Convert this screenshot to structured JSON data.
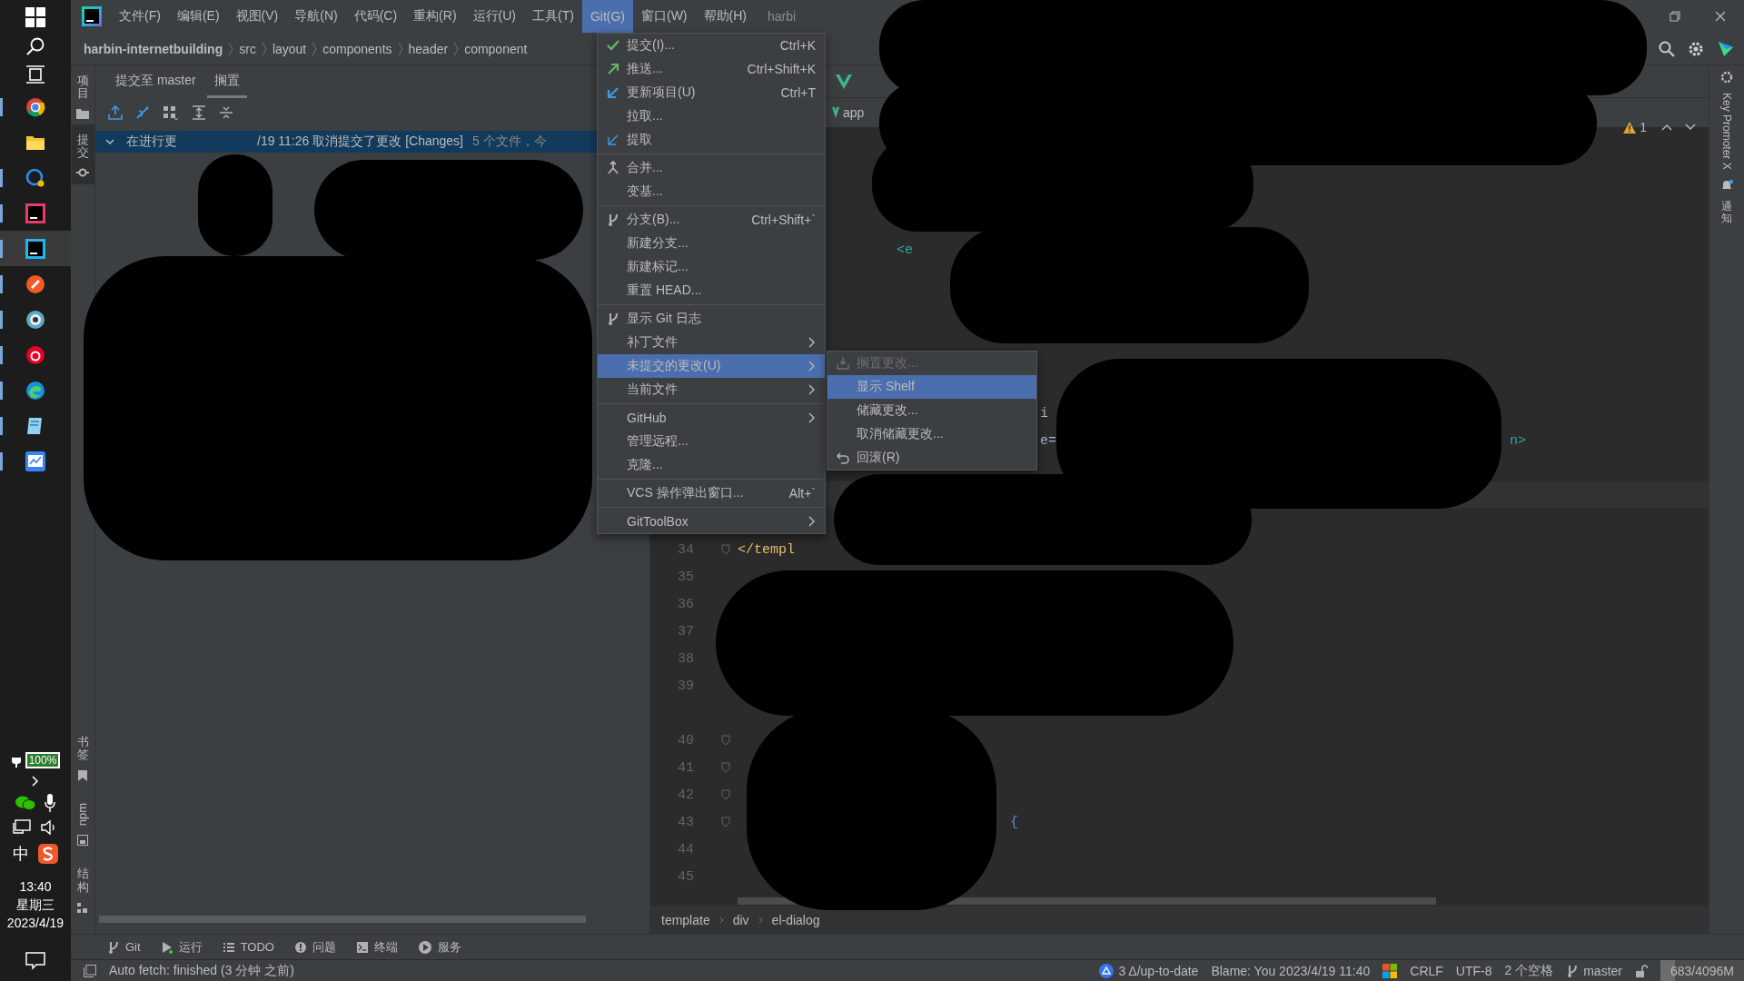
{
  "taskbar": {
    "apps": [
      {
        "kind": "chrome",
        "running": true,
        "selected": false
      },
      {
        "kind": "folder",
        "running": false,
        "selected": false
      },
      {
        "kind": "chat",
        "running": true,
        "selected": false
      },
      {
        "kind": "intellij",
        "running": true,
        "selected": false
      },
      {
        "kind": "webstorm",
        "running": true,
        "selected": true
      },
      {
        "kind": "pen",
        "running": true,
        "selected": false
      },
      {
        "kind": "globe",
        "running": true,
        "selected": false
      },
      {
        "kind": "music",
        "running": true,
        "selected": false
      },
      {
        "kind": "edge",
        "running": true,
        "selected": false
      },
      {
        "kind": "note",
        "running": true,
        "selected": false
      },
      {
        "kind": "board",
        "running": true,
        "selected": false
      }
    ],
    "battery": "100%",
    "input_method": "中",
    "time": "13:40",
    "weekday": "星期三",
    "date": "2023/4/19"
  },
  "menu_bar": {
    "items": [
      {
        "label": "文件(F)",
        "selected": false
      },
      {
        "label": "编辑(E)",
        "selected": false
      },
      {
        "label": "视图(V)",
        "selected": false
      },
      {
        "label": "导航(N)",
        "selected": false
      },
      {
        "label": "代码(C)",
        "selected": false
      },
      {
        "label": "重构(R)",
        "selected": false
      },
      {
        "label": "运行(U)",
        "selected": false
      },
      {
        "label": "工具(T)",
        "selected": false
      },
      {
        "label": "Git(G)",
        "selected": true
      },
      {
        "label": "窗口(W)",
        "selected": false
      },
      {
        "label": "帮助(H)",
        "selected": false
      }
    ],
    "title": "harbi"
  },
  "breadcrumb": [
    "harbin-internetbuilding",
    "src",
    "layout",
    "components",
    "header",
    "component"
  ],
  "left_strip": {
    "top": [
      {
        "label": "项目",
        "selected": false
      },
      {
        "label": "提交",
        "selected": true
      }
    ],
    "bottom": [
      "书签",
      "npm",
      "结构"
    ]
  },
  "commit_panel": {
    "tabs": [
      {
        "label": "提交至 master",
        "selected": false
      },
      {
        "label": "搁置",
        "selected": true
      }
    ],
    "header": {
      "expanded": true,
      "parts": [
        "在进行更",
        "/19 11:26 取消提交了更改 [Changes]"
      ],
      "note": "5 个文件，今"
    }
  },
  "editor": {
    "tab_fragment": "app",
    "warnings": "1",
    "upper_code": [
      "<e",
      "i",
      "e=",
      "n>"
    ],
    "lines": [
      {
        "number": "34",
        "code": "</templ"
      },
      {
        "number": "35"
      },
      {
        "number": "36"
      },
      {
        "number": "37"
      },
      {
        "number": "38"
      },
      {
        "number": "39"
      },
      {
        "number": "40"
      },
      {
        "number": "41"
      },
      {
        "number": "42"
      },
      {
        "number": "43",
        "code": "{"
      },
      {
        "number": "44"
      },
      {
        "number": "45"
      }
    ],
    "breadcrumb": [
      "template",
      "div",
      "el-dialog"
    ]
  },
  "right_strip": [
    "Key Promoter X",
    "通知"
  ],
  "tool_windows": [
    {
      "label": "Git"
    },
    {
      "label": "运行"
    },
    {
      "label": "TODO"
    },
    {
      "label": "问题"
    },
    {
      "label": "终端"
    },
    {
      "label": "服务"
    }
  ],
  "status_bar": {
    "message": "Auto fetch: finished (3 分钟 之前)",
    "toolbox": "3 Δ/up-to-date",
    "blame": "Blame: You 2023/4/19 11:40",
    "line_ending": "CRLF",
    "encoding": "UTF-8",
    "indent": "2 个空格",
    "branch": "master",
    "memory": {
      "text": "683/4096M",
      "level": 0.17
    }
  },
  "git_menu": {
    "items": [
      {
        "kind": "item",
        "label": "提交(I)...",
        "shortcut": "Ctrl+K",
        "submenu": false,
        "selected": false
      },
      {
        "kind": "item",
        "label": "推送...",
        "shortcut": "Ctrl+Shift+K",
        "submenu": false,
        "selected": false
      },
      {
        "kind": "item",
        "label": "更新项目(U)",
        "shortcut": "Ctrl+T",
        "submenu": false,
        "selected": false
      },
      {
        "kind": "item",
        "label": "拉取...",
        "submenu": false,
        "selected": false
      },
      {
        "kind": "item",
        "label": "提取",
        "submenu": false,
        "selected": false
      },
      {
        "kind": "separator"
      },
      {
        "kind": "item",
        "label": "合并...",
        "submenu": false,
        "selected": false
      },
      {
        "kind": "item",
        "label": "变基...",
        "submenu": false,
        "selected": false
      },
      {
        "kind": "separator"
      },
      {
        "kind": "item",
        "label": "分支(B)...",
        "shortcut": "Ctrl+Shift+`",
        "submenu": false,
        "selected": false
      },
      {
        "kind": "item",
        "label": "新建分支...",
        "submenu": false,
        "selected": false
      },
      {
        "kind": "item",
        "label": "新建标记...",
        "submenu": false,
        "selected": false
      },
      {
        "kind": "item",
        "label": "重置 HEAD...",
        "submenu": false,
        "selected": false
      },
      {
        "kind": "separator"
      },
      {
        "kind": "item",
        "label": "显示 Git 日志",
        "submenu": false,
        "selected": false
      },
      {
        "kind": "item",
        "label": "补丁文件",
        "submenu": true,
        "selected": false
      },
      {
        "kind": "item",
        "label": "未提交的更改(U)",
        "submenu": true,
        "selected": true
      },
      {
        "kind": "item",
        "label": "当前文件",
        "submenu": true,
        "selected": false
      },
      {
        "kind": "separator"
      },
      {
        "kind": "item",
        "label": "GitHub",
        "submenu": true,
        "selected": false
      },
      {
        "kind": "item",
        "label": "管理远程...",
        "submenu": false,
        "selected": false
      },
      {
        "kind": "item",
        "label": "克隆...",
        "submenu": false,
        "selected": false
      },
      {
        "kind": "separator"
      },
      {
        "kind": "item",
        "label": "VCS 操作弹出窗口...",
        "shortcut": "Alt+`",
        "submenu": false,
        "selected": false
      },
      {
        "kind": "separator"
      },
      {
        "kind": "item",
        "label": "GitToolBox",
        "submenu": true,
        "selected": false
      }
    ]
  },
  "submenu": {
    "items": [
      {
        "kind": "item",
        "label": "搁置更改...",
        "disabled": true,
        "selected": false
      },
      {
        "kind": "item",
        "label": "显示 Shelf",
        "disabled": false,
        "selected": true
      },
      {
        "kind": "item",
        "label": "储藏更改...",
        "disabled": false,
        "selected": false
      },
      {
        "kind": "item",
        "label": "取消储藏更改...",
        "disabled": false,
        "selected": false
      },
      {
        "kind": "item",
        "label": "回滚(R)",
        "disabled": false,
        "selected": false
      }
    ]
  }
}
